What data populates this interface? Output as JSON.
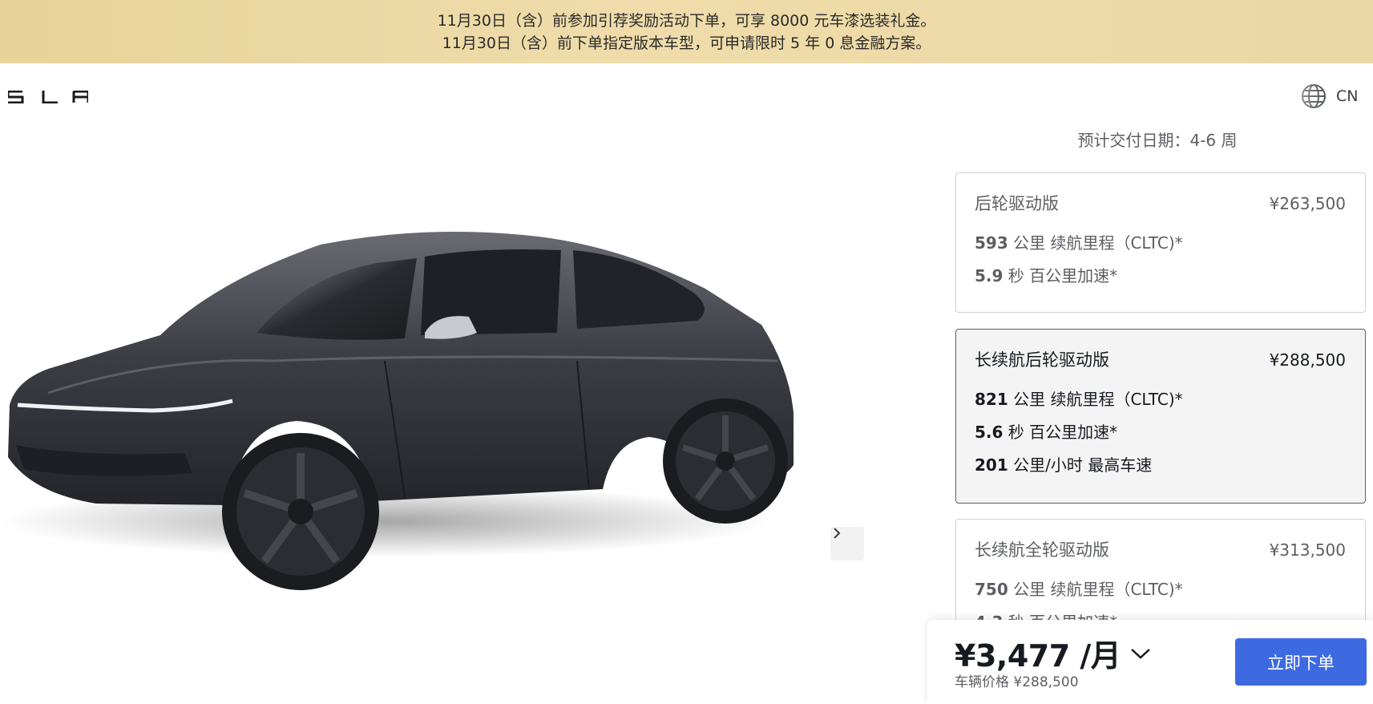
{
  "banner": {
    "line1": "11月30日（含）前参加引荐奖励活动下单，可享 8000 元车漆选装礼金。",
    "line2": "11月30日（含）前下单指定版本车型，可申请限时 5 年 0 息金融方案。"
  },
  "header": {
    "logo_icon": "tesla-wordmark-icon",
    "language_icon": "globe-icon",
    "language_label": "CN"
  },
  "gallery": {
    "next_icon": "chevron-right-icon"
  },
  "delivery": {
    "label": "预计交付日期：",
    "value": "4-6 周"
  },
  "trims": [
    {
      "name": "后轮驱动版",
      "price": "¥263,500",
      "selected": false,
      "specs": [
        {
          "value": "593",
          "text": " 公里 续航里程（CLTC)*"
        },
        {
          "value": "5.9",
          "text": " 秒 百公里加速*"
        }
      ]
    },
    {
      "name": "长续航后轮驱动版",
      "price": "¥288,500",
      "selected": true,
      "specs": [
        {
          "value": "821",
          "text": " 公里 续航里程（CLTC)*"
        },
        {
          "value": "5.6",
          "text": " 秒 百公里加速*"
        },
        {
          "value": "201",
          "text": " 公里/小时 最高车速"
        }
      ]
    },
    {
      "name": "长续航全轮驱动版",
      "price": "¥313,500",
      "selected": false,
      "specs": [
        {
          "value": "750",
          "text": " 公里 续航里程（CLTC)*"
        },
        {
          "value": "4.3",
          "text": " 秒 百公里加速*"
        }
      ]
    }
  ],
  "bottom_bar": {
    "monthly_price": "¥3,477 /月",
    "vehicle_price": "车辆价格 ¥288,500",
    "order_button": "立即下单",
    "expand_icon": "chevron-down-icon"
  },
  "colors": {
    "banner_gold": "#ecd8a4",
    "accent_blue": "#3e6ae1",
    "text_dark": "#171a20",
    "text_gray": "#5c5e62"
  }
}
